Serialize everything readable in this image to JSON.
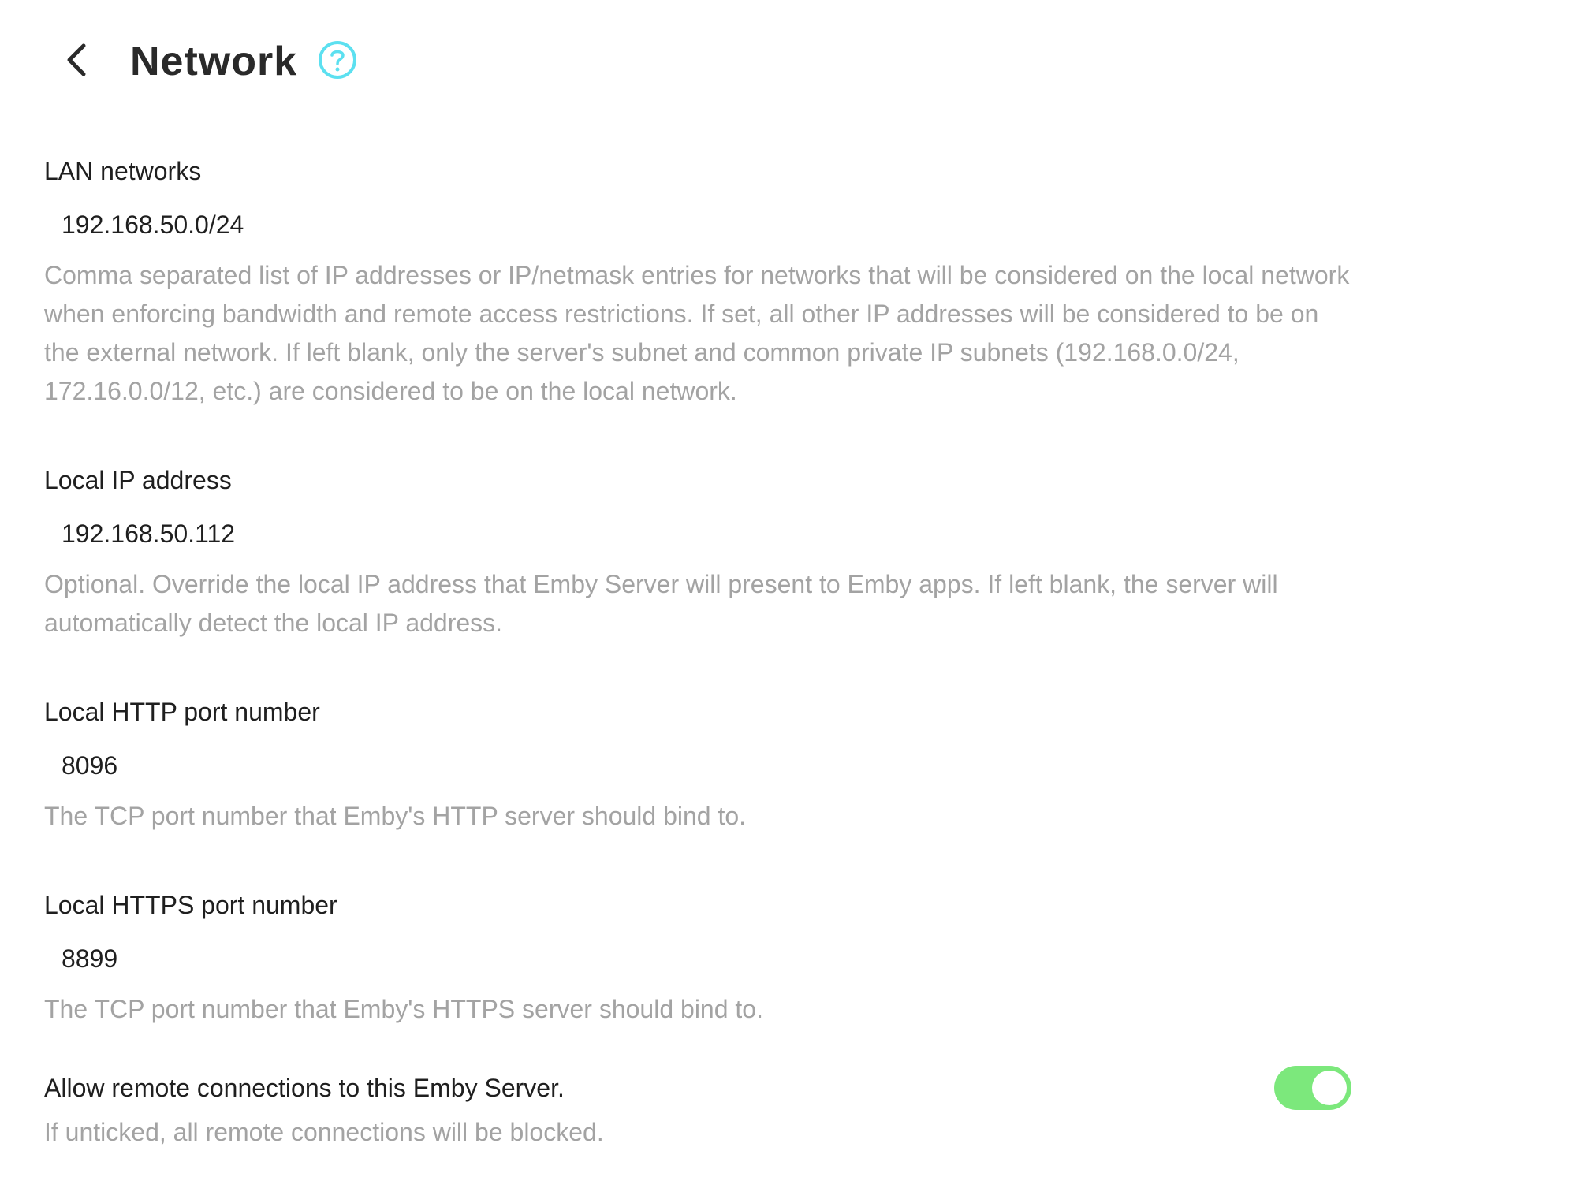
{
  "header": {
    "title": "Network",
    "back_icon": "chevron-left-icon",
    "help_icon": "question-circle-icon",
    "help_color": "#5ce0f0"
  },
  "fields": {
    "lan_networks": {
      "label": "LAN networks",
      "value": "192.168.50.0/24",
      "description": "Comma separated list of IP addresses or IP/netmask entries for networks that will be considered on the local network when enforcing bandwidth and remote access restrictions. If set, all other IP addresses will be considered to be on the external network. If left blank, only the server's subnet and common private IP subnets (192.168.0.0/24, 172.16.0.0/12, etc.) are considered to be on the local network."
    },
    "local_ip": {
      "label": "Local IP address",
      "value": "192.168.50.112",
      "description": "Optional. Override the local IP address that Emby Server will present to Emby apps. If left blank, the server will automatically detect the local IP address."
    },
    "http_port": {
      "label": "Local HTTP port number",
      "value": "8096",
      "description": "The TCP port number that Emby's HTTP server should bind to."
    },
    "https_port": {
      "label": "Local HTTPS port number",
      "value": "8899",
      "description": "The TCP port number that Emby's HTTPS server should bind to."
    }
  },
  "remote_access": {
    "label": "Allow remote connections to this Emby Server.",
    "description": "If unticked, all remote connections will be blocked.",
    "enabled": true,
    "toggle_color": "#7ce87c"
  }
}
